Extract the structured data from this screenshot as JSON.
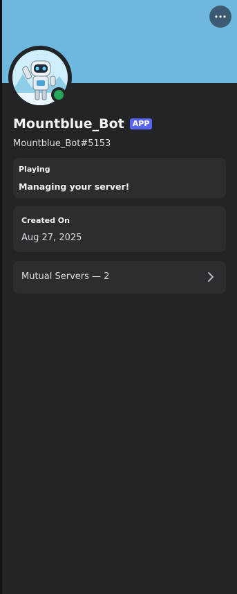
{
  "profile": {
    "display_name": "Mountblue_Bot",
    "badge": "APP",
    "username": "Mountblue_Bot#5153",
    "status": "online",
    "banner_color": "#6eb8df"
  },
  "activity": {
    "heading": "Playing",
    "value": "Managing your server!"
  },
  "created": {
    "heading": "Created On",
    "value": "Aug 27, 2025"
  },
  "mutual": {
    "label": "Mutual Servers — 2"
  },
  "icons": {
    "more": "ellipsis-icon",
    "chevron": "chevron-right-icon",
    "avatar": "robot-avatar"
  }
}
